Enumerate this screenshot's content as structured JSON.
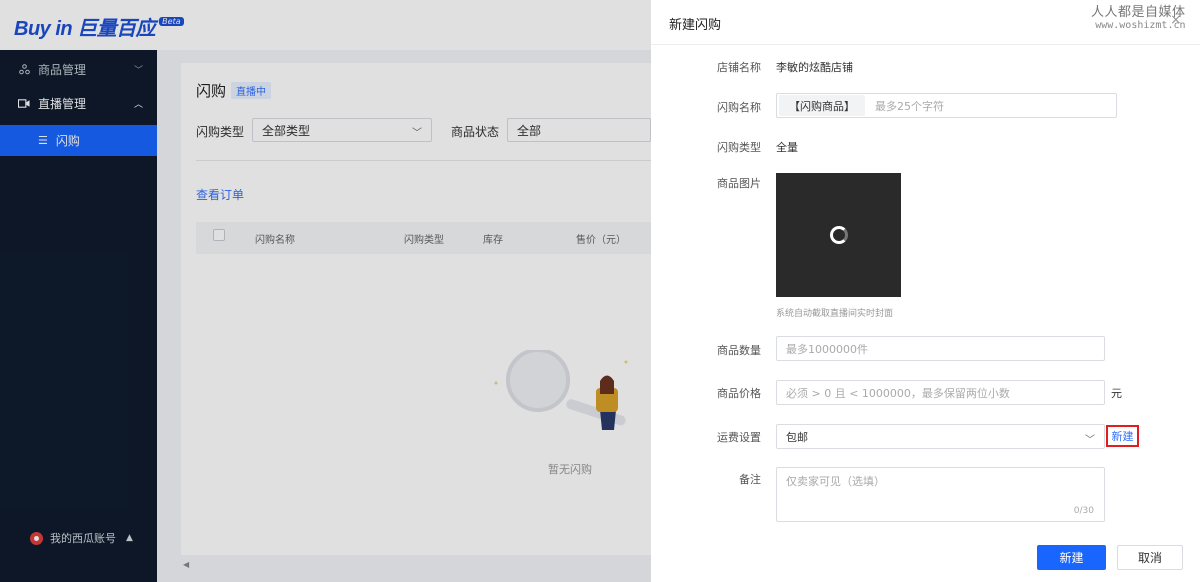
{
  "app": {
    "brand": "Buy in 巨量百应",
    "beta": "Beta"
  },
  "sidebar": {
    "items": [
      {
        "label": "商品管理",
        "icon": "products-icon"
      },
      {
        "label": "直播管理",
        "icon": "video-icon"
      }
    ],
    "active_subitem": {
      "label": "闪购",
      "icon": "list-icon"
    },
    "account_label": "我的西瓜账号"
  },
  "main": {
    "title": "闪购",
    "status_tag": "直播中",
    "filters": {
      "type_label": "闪购类型",
      "type_value": "全部类型",
      "status_label": "商品状态",
      "status_value": "全部"
    },
    "view_orders": "查看订单",
    "columns": [
      "闪购名称",
      "闪购类型",
      "库存",
      "售价（元）"
    ],
    "empty_text": "暂无闪购"
  },
  "drawer": {
    "title": "新建闪购",
    "close": "×",
    "watermark_line1": "人人都是自媒体",
    "watermark_line2": "www.woshizmt.cn",
    "fields": {
      "shop_label": "店铺名称",
      "shop_value": "李敏的炫酷店铺",
      "name_label": "闪购名称",
      "name_prefix": "【闪购商品】",
      "name_placeholder": "最多25个字符",
      "type_label": "闪购类型",
      "type_value": "全量",
      "image_label": "商品图片",
      "image_hint": "系统自动截取直播间实时封面",
      "qty_label": "商品数量",
      "qty_placeholder": "最多1000000件",
      "price_label": "商品价格",
      "price_placeholder": "必须 > 0 且 < 1000000，最多保留两位小数",
      "price_unit": "元",
      "shipping_label": "运费设置",
      "shipping_value": "包邮",
      "shipping_new": "新建",
      "note_label": "备注",
      "note_placeholder": "仅卖家可见（选填）",
      "note_counter": "0/30"
    },
    "buttons": {
      "submit": "新建",
      "cancel": "取消"
    }
  },
  "colors": {
    "accent": "#1966ff",
    "sidebar": "#0f1b2d",
    "highlight": "#e01e1e"
  }
}
